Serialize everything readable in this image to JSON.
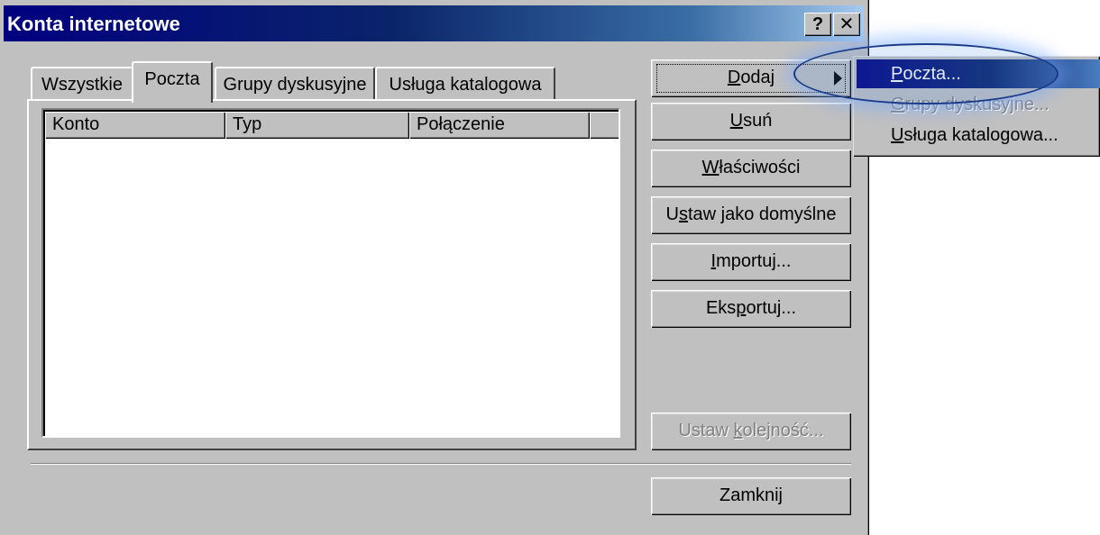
{
  "window": {
    "title": "Konta internetowe",
    "help_glyph": "?",
    "close_glyph": "✕"
  },
  "tabs": [
    {
      "label": "Wszystkie",
      "active": false
    },
    {
      "label": "Poczta",
      "active": true
    },
    {
      "label": "Grupy dyskusyjne",
      "active": false
    },
    {
      "label": "Usługa katalogowa",
      "active": false
    }
  ],
  "list": {
    "columns": [
      "Konto",
      "Typ",
      "Połączenie",
      ""
    ]
  },
  "buttons": {
    "add": {
      "pre": "",
      "key": "D",
      "post": "odaj"
    },
    "remove": {
      "pre": "",
      "key": "U",
      "post": "suń"
    },
    "properties": {
      "pre": "",
      "key": "W",
      "post": "łaściwości"
    },
    "set_default": {
      "pre": "U",
      "key": "s",
      "post": "taw jako domyślne"
    },
    "import": {
      "pre": "",
      "key": "I",
      "post": "mportuj..."
    },
    "export": {
      "pre": "Eks",
      "key": "p",
      "post": "ortuj..."
    },
    "set_order": {
      "pre": "Ustaw ",
      "key": "k",
      "post": "olejność..."
    },
    "close": "Zamknij"
  },
  "submenu": [
    {
      "key": "P",
      "post": "oczta...",
      "state": "selected"
    },
    {
      "key": "G",
      "post": "rupy dyskusyjne...",
      "state": "disabled"
    },
    {
      "key": "U",
      "post": "sługa katalogowa...",
      "state": "normal"
    }
  ],
  "colors": {
    "face": "#c0c0c0",
    "title_start": "#000080",
    "title_end": "#a6caf0",
    "highlight": "#0a246a"
  }
}
